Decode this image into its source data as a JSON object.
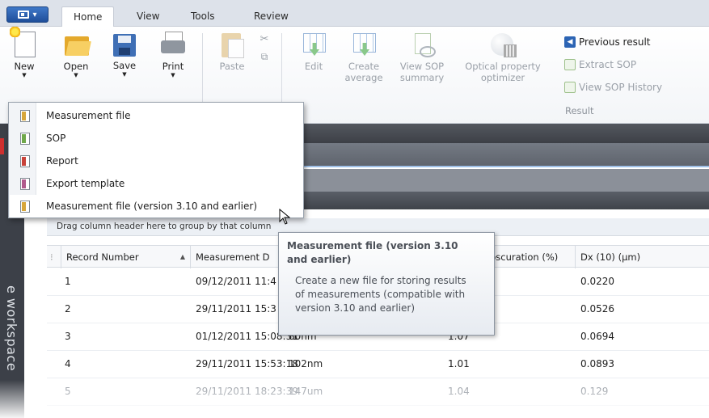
{
  "tabs": [
    {
      "label": "Home"
    },
    {
      "label": "View"
    },
    {
      "label": "Tools"
    },
    {
      "label": "Review"
    }
  ],
  "ribbon": {
    "new": "New",
    "open": "Open",
    "save": "Save",
    "print": "Print",
    "paste": "Paste",
    "edit": "Edit",
    "create_average_1": "Create",
    "create_average_2": "average",
    "view_sop_summary_1": "View SOP",
    "view_sop_summary_2": "summary",
    "optical_1": "Optical property",
    "optical_2": "optimizer",
    "previous_result": "Previous result",
    "extract_sop": "Extract SOP",
    "view_sop_history": "View SOP History",
    "result_group": "Result"
  },
  "new_menu": {
    "items": [
      {
        "label": "Measurement file"
      },
      {
        "label": "SOP"
      },
      {
        "label": "Report"
      },
      {
        "label": "Export template"
      },
      {
        "label": "Measurement file (version 3.10 and earlier)"
      }
    ]
  },
  "tooltip": {
    "title_1": "Measurement file (version 3.10",
    "title_2": "and earlier)",
    "desc_1": "Create a new file for storing results",
    "desc_2": "of measurements (compatible with",
    "desc_3": "version 3.10 and earlier)"
  },
  "workspace_label": "e workspace",
  "group_hint": "Drag column header here to group by that column",
  "grid": {
    "headers": [
      "Record Number",
      "Measurement D",
      "pscuration (%)",
      "Dx (10) (µm)"
    ],
    "rows": [
      {
        "record": "1",
        "date": "09/12/2011 11:4",
        "name": "",
        "obscuration": "",
        "dx10": "0.0220"
      },
      {
        "record": "2",
        "date": "29/11/2011 15:3",
        "name": "",
        "obscuration": "",
        "dx10": "0.0526"
      },
      {
        "record": "3",
        "date": "01/12/2011 15:08:31",
        "name": "80nm",
        "obscuration": "1.07",
        "dx10": "0.0694"
      },
      {
        "record": "4",
        "date": "29/11/2011 15:53:18",
        "name": "102nm",
        "obscuration": "1.01",
        "dx10": "0.0893"
      },
      {
        "record": "5",
        "date": "29/11/2011 18:23:39",
        "name": "147um",
        "obscuration": "1.04",
        "dx10": "0.129"
      }
    ]
  },
  "colors": {
    "accent_blue": "#2c64b4",
    "sidebar_dark": "#3c4048"
  }
}
